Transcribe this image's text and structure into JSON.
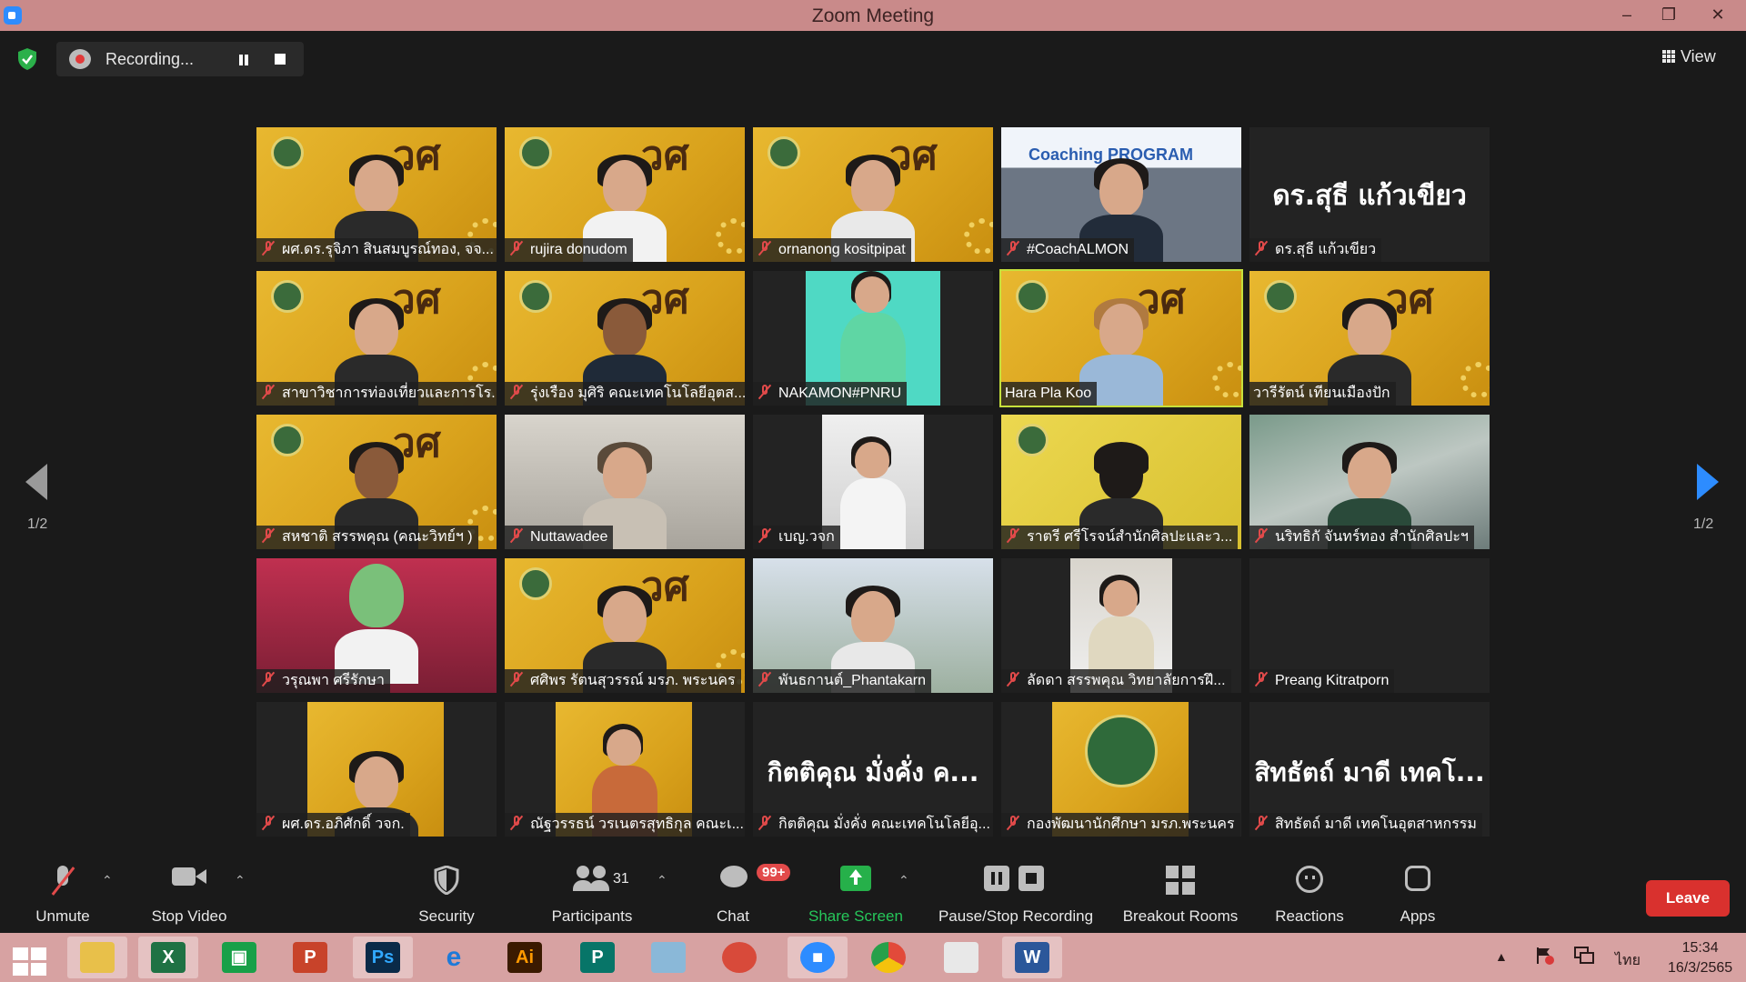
{
  "window": {
    "title": "Zoom Meeting"
  },
  "topbar": {
    "recording_label": "Recording...",
    "view_label": "View"
  },
  "pagination": {
    "left": "1/2",
    "right": "1/2"
  },
  "tiles": [
    {
      "name": "ผศ.ดร.รุจิภา สินสมบูรณ์ทอง, จจ...",
      "muted": true
    },
    {
      "name": "rujira donudom",
      "muted": true
    },
    {
      "name": "ornanong kositpipat",
      "muted": true
    },
    {
      "name": "#CoachALMON",
      "muted": true,
      "banner": "Coaching PROGRAM"
    },
    {
      "name": "ดร.สุธี แก้วเขียว",
      "muted": true,
      "display": "ดร.สุธี แก้วเขียว"
    },
    {
      "name": "สาขาวิชาการท่องเที่ยวและการโร...",
      "muted": true
    },
    {
      "name": "รุ่งเรือง มุศิริ คณะเทคโนโลยีอุตส...",
      "muted": true
    },
    {
      "name": "NAKAMON#PNRU",
      "muted": true
    },
    {
      "name": "Hara Pla Koo",
      "muted": false,
      "active": true
    },
    {
      "name": "วารีรัตน์ เทียนเมืองปัก",
      "muted": false
    },
    {
      "name": "สหชาติ สรรพคุณ (คณะวิทย์ฯ )",
      "muted": true
    },
    {
      "name": "Nuttawadee",
      "muted": true
    },
    {
      "name": "เบญ.วจก",
      "muted": true
    },
    {
      "name": "ราตรี ศรีโรจน์สำนักศิลปะและว...",
      "muted": true
    },
    {
      "name": "นริทธิกั จันทร์ทอง สำนักศิลปะฯ",
      "muted": true
    },
    {
      "name": "วรุณพา ศรีรักษา",
      "muted": true
    },
    {
      "name": "ศศิพร รัตนสุวรรณ์ มรภ. พระนคร",
      "muted": true
    },
    {
      "name": "พันธกานต์_Phantakarn",
      "muted": true
    },
    {
      "name": "ลัดดา สรรพคุณ วิทยาลัยการฝึ...",
      "muted": true
    },
    {
      "name": "Preang Kitratporn",
      "muted": true
    },
    {
      "name": "ผศ.ดร.อภิศักดิ์ วจก.",
      "muted": true
    },
    {
      "name": "ณัฐวรรธน์ วรเนตรสุทธิกุล คณะเ...",
      "muted": true
    },
    {
      "name": "กิตติคุณ มั่งคั่ง คณะเทคโนโลยีอุ...",
      "muted": true,
      "display": "กิตติคุณ มั่งคั่ง ค..."
    },
    {
      "name": "กองพัฒนานักศึกษา มรภ.พระนคร",
      "muted": true
    },
    {
      "name": "สิทธัตถ์ มาดี เทคโนอุตสาหกรรม",
      "muted": true,
      "display": "สิทธัตถ์ มาดี เทคโ..."
    }
  ],
  "toolbar": {
    "unmute": "Unmute",
    "stop_video": "Stop Video",
    "security": "Security",
    "participants": "Participants",
    "participants_count": "31",
    "chat": "Chat",
    "chat_badge": "99+",
    "share_screen": "Share Screen",
    "pause_stop_recording": "Pause/Stop Recording",
    "breakout_rooms": "Breakout Rooms",
    "reactions": "Reactions",
    "apps": "Apps",
    "leave": "Leave"
  },
  "taskbar": {
    "apps": [
      "File Explorer",
      "Excel",
      "Store",
      "PowerPoint",
      "Photoshop",
      "Internet Explorer",
      "Illustrator",
      "Publisher",
      "Notepad",
      "PhotoScape",
      "Zoom",
      "Chrome",
      "Office",
      "Word"
    ],
    "language": "ไทย",
    "time": "15:34",
    "date": "16/3/2565"
  },
  "colors": {
    "titlebar": "#c98a8a",
    "taskbar": "#d7a2a2",
    "leave": "#d9312e",
    "share": "#26c75a",
    "accent": "#2d8cff",
    "active_speaker": "#c6e03c"
  }
}
